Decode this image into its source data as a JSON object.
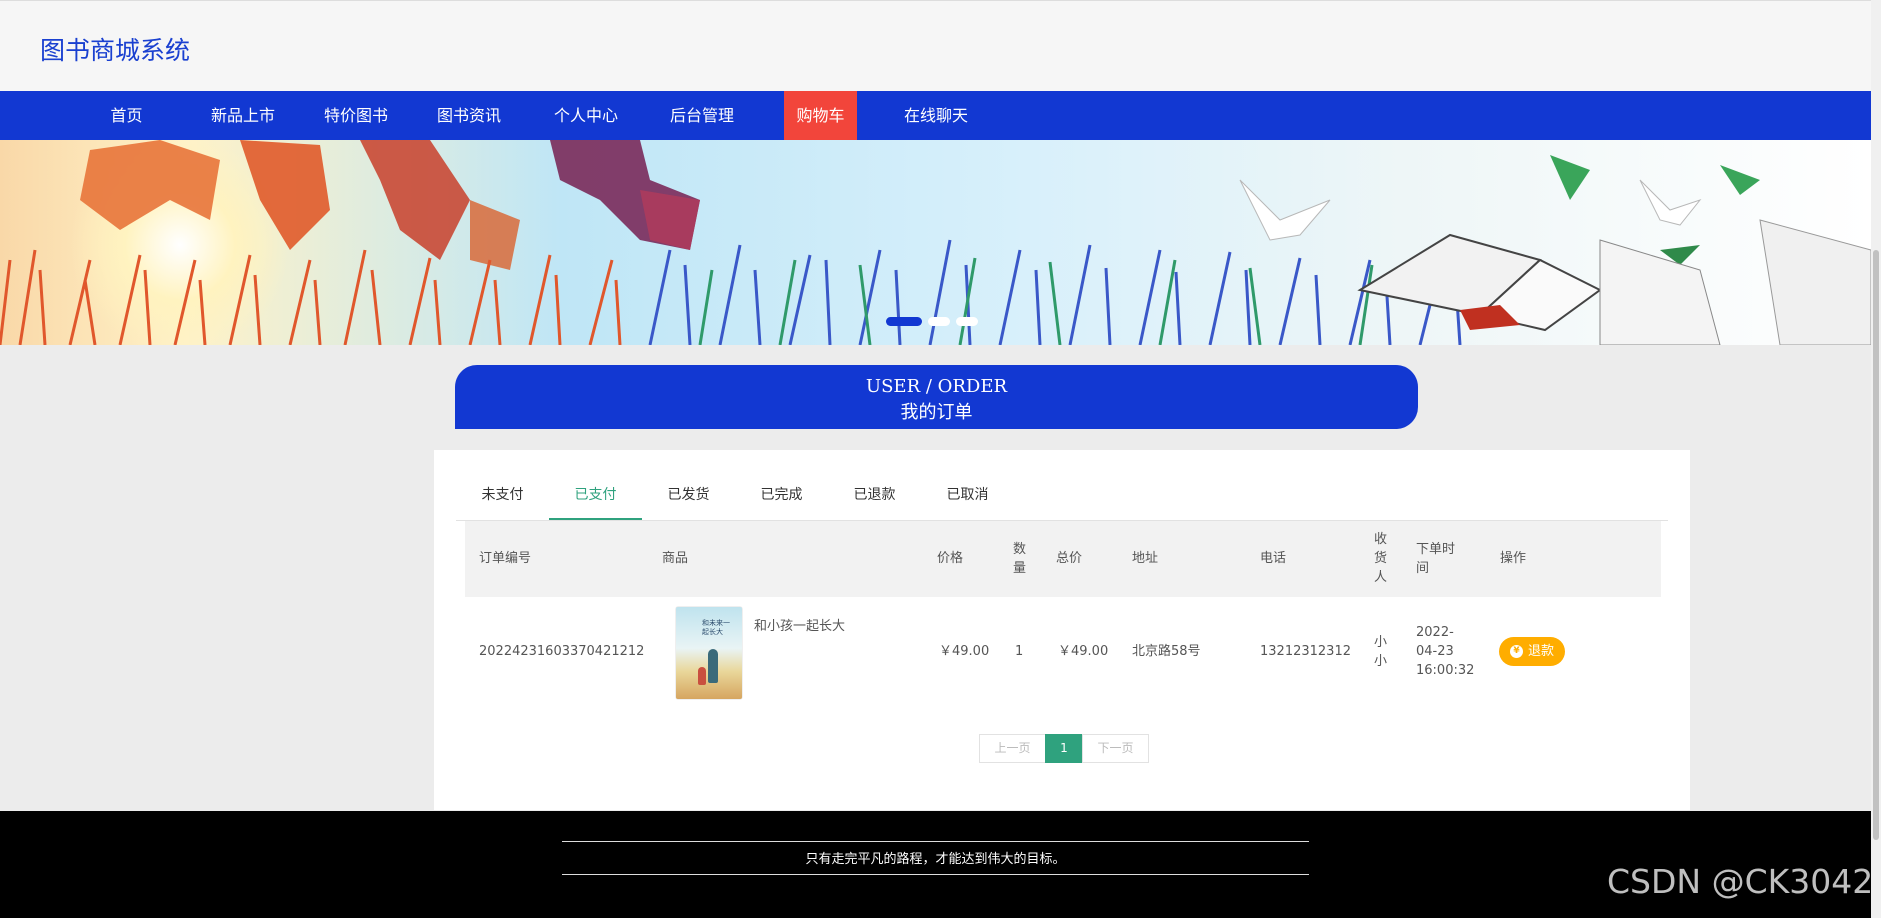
{
  "site": {
    "title": "图书商城系统"
  },
  "nav": {
    "items": [
      {
        "label": "首页"
      },
      {
        "label": "新品上市"
      },
      {
        "label": "特价图书"
      },
      {
        "label": "图书资讯"
      },
      {
        "label": "个人中心"
      },
      {
        "label": "后台管理"
      },
      {
        "label": "购物车"
      },
      {
        "label": "在线聊天"
      }
    ],
    "active_index": 6,
    "active_color": "#f2453b",
    "bar_color": "#1238d2"
  },
  "banner": {
    "slide_count": 3,
    "active_slide": 0
  },
  "section": {
    "title_en": "USER / ORDER",
    "title_zh": "我的订单"
  },
  "tabs": {
    "items": [
      "未支付",
      "已支付",
      "已发货",
      "已完成",
      "已退款",
      "已取消"
    ],
    "active_index": 1,
    "active_color": "#2fa27e"
  },
  "table": {
    "headers": {
      "order_no": "订单编号",
      "product": "商品",
      "price": "价格",
      "qty": [
        "数",
        "量"
      ],
      "total": "总价",
      "address": "地址",
      "phone": "电话",
      "receiver": [
        "收",
        "货",
        "人"
      ],
      "time": [
        "下单时",
        "间"
      ],
      "action": "操作"
    },
    "rows": [
      {
        "order_no": "20224231603370421212",
        "product_name": "和小孩一起长大",
        "cover_text": "和未来一起长大",
        "price": "￥49.00",
        "qty": "1",
        "total": "￥49.00",
        "address": "北京路58号",
        "phone": "13212312312",
        "receiver": [
          "小",
          "小"
        ],
        "time": [
          "2022-",
          "04-23",
          "16:00:32"
        ],
        "action_label": "退款",
        "action_icon": "yen-icon"
      }
    ]
  },
  "pagination": {
    "prev": "上一页",
    "current": "1",
    "next": "下一页"
  },
  "footer": {
    "slogan": "只有走完平凡的路程，才能达到伟大的目标。"
  },
  "watermark": "CSDN @CK3042"
}
